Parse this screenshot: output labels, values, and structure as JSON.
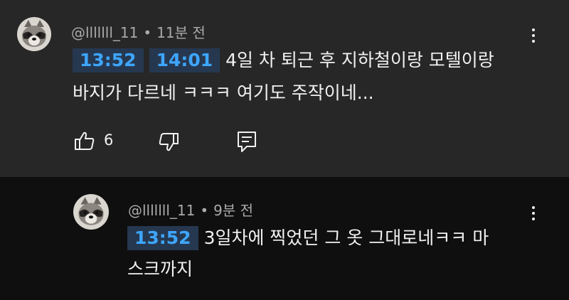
{
  "comment": {
    "username": "@lllllll_11",
    "time": "11분 전",
    "timestamps": [
      "13:52",
      "14:01"
    ],
    "text_line1": "4일 차 퇴근 후 지하철이랑 모텔이랑",
    "text_line2": "바지가 다르네 ㅋㅋㅋ 여기도 주작이네...",
    "like_count": "6",
    "avatar_icon": "raccoon-avatar",
    "like_icon": "thumbs-up-icon",
    "dislike_icon": "thumbs-down-icon",
    "reply_icon": "reply-icon",
    "more_icon": "kebab-menu-icon"
  },
  "reply": {
    "username": "@lllllll_11",
    "time": "9분 전",
    "timestamps": [
      "13:52"
    ],
    "text_line1": "3일차에 찍었던 그 옷 그대로네ㅋㅋ 마",
    "text_line2": "스크까지",
    "avatar_icon": "raccoon-avatar",
    "more_icon": "kebab-menu-icon"
  },
  "colors": {
    "comment_background": "#272727",
    "reply_background": "#0f0f0f",
    "timestamp_link": "#3ea6ff",
    "timestamp_chip": "#263850",
    "meta_text": "#aaaaaa"
  }
}
